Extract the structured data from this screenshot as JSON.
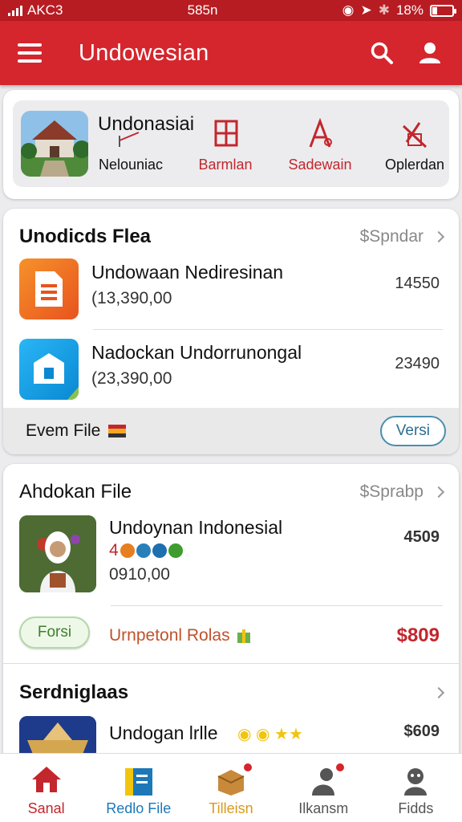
{
  "status": {
    "carrier": "AKC3",
    "time": "585n",
    "battery": "18%"
  },
  "appbar": {
    "title": "Undowesian"
  },
  "hero": {
    "title": "Undonasiai",
    "items": [
      {
        "label": "Nelouniac",
        "icon": "document-icon"
      },
      {
        "label": "Barmlan",
        "icon": "grid-document-icon"
      },
      {
        "label": "Sadewain",
        "icon": "letter-a-icon"
      },
      {
        "label": "Oplerdan",
        "icon": "tool-icon"
      }
    ]
  },
  "section1": {
    "title": "Unodicds Flea",
    "link": "$Spndar",
    "rows": [
      {
        "name": "Undowaan Nediresinan",
        "sub": "(13,390,00",
        "value": "14550",
        "icon": "spreadsheet-icon"
      },
      {
        "name": "Nadockan Undorrunongal",
        "sub": "(23,390,00",
        "value": "23490",
        "icon": "store-icon"
      }
    ],
    "footer": {
      "text": "Evem File",
      "button": "Versi"
    }
  },
  "section2": {
    "title": "Ahdokan File",
    "link": "$Sprabp",
    "row": {
      "name": "Undoynan Indonesial",
      "badge": "4",
      "sub": "0910,00",
      "value": "4509"
    },
    "tag_button": "Forsi",
    "promo": "Urnpetonl Rolas",
    "promo_value": "$809"
  },
  "section3": {
    "title": "Serdniglaas",
    "row": {
      "name": "Undogan lrlle",
      "value": "$609"
    }
  },
  "tabs": [
    {
      "label": "Sanal",
      "color": "#c3262d"
    },
    {
      "label": "Redlo File",
      "color": "#1d78b8"
    },
    {
      "label": "Tilleisn",
      "color": "#d89a1c"
    },
    {
      "label": "Ilkansm",
      "color": "#555555"
    },
    {
      "label": "Fidds",
      "color": "#555555"
    }
  ],
  "colors": {
    "primary": "#d5262d",
    "green": "#3f9c2e",
    "price_red": "#c3262d"
  }
}
